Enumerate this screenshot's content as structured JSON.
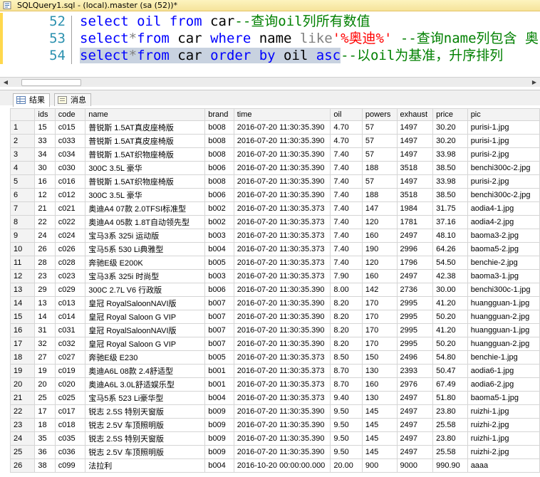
{
  "window": {
    "tab_title": "SQLQuery1.sql - (local).master (sa (52))*"
  },
  "editor": {
    "lines": [
      {
        "number": "52",
        "segments": [
          {
            "cls": "kw",
            "text": "select "
          },
          {
            "cls": "kw",
            "text": "oil "
          },
          {
            "cls": "kw",
            "text": "from "
          },
          {
            "cls": "fn",
            "text": "car"
          },
          {
            "cls": "cm",
            "text": "--查询oil列所有数值"
          }
        ]
      },
      {
        "number": "53",
        "segments": [
          {
            "cls": "kw",
            "text": "select"
          },
          {
            "cls": "gr",
            "text": "*"
          },
          {
            "cls": "kw",
            "text": "from "
          },
          {
            "cls": "fn",
            "text": "car "
          },
          {
            "cls": "kw",
            "text": "where "
          },
          {
            "cls": "fn",
            "text": "name "
          },
          {
            "cls": "gr",
            "text": "like"
          },
          {
            "cls": "str",
            "text": "'%奥迪%'"
          },
          {
            "cls": "cm",
            "text": " --查询name列包含 奥"
          }
        ]
      },
      {
        "number": "54",
        "segments": [
          {
            "cls": "kw sel",
            "text": "select"
          },
          {
            "cls": "gr sel",
            "text": "*"
          },
          {
            "cls": "kw sel",
            "text": "from "
          },
          {
            "cls": "fn sel",
            "text": "car "
          },
          {
            "cls": "kw sel",
            "text": "order by "
          },
          {
            "cls": "fn sel",
            "text": "oil "
          },
          {
            "cls": "kw sel",
            "text": "asc"
          },
          {
            "cls": "cm",
            "text": "--以oil为基准，升序排列"
          }
        ]
      }
    ]
  },
  "result_tabs": {
    "results": "结果",
    "messages": "消息"
  },
  "grid": {
    "columns": [
      "",
      "ids",
      "code",
      "name",
      "brand",
      "time",
      "oil",
      "powers",
      "exhaust",
      "price",
      "pic"
    ],
    "rows": [
      [
        "1",
        "15",
        "c015",
        "普锐斯 1.5AT真皮座椅版",
        "b008",
        "2016-07-20 11:30:35.390",
        "4.70",
        "57",
        "1497",
        "30.20",
        "purisi-1.jpg"
      ],
      [
        "2",
        "33",
        "c033",
        "普锐斯 1.5AT真皮座椅版",
        "b008",
        "2016-07-20 11:30:35.390",
        "4.70",
        "57",
        "1497",
        "30.20",
        "purisi-1.jpg"
      ],
      [
        "3",
        "34",
        "c034",
        "普锐斯 1.5AT织物座椅版",
        "b008",
        "2016-07-20 11:30:35.390",
        "7.40",
        "57",
        "1497",
        "33.98",
        "purisi-2.jpg"
      ],
      [
        "4",
        "30",
        "c030",
        "300C 3.5L 豪华",
        "b006",
        "2016-07-20 11:30:35.390",
        "7.40",
        "188",
        "3518",
        "38.50",
        "benchi300c-2.jpg"
      ],
      [
        "5",
        "16",
        "c016",
        "普锐斯 1.5AT织物座椅版",
        "b008",
        "2016-07-20 11:30:35.390",
        "7.40",
        "57",
        "1497",
        "33.98",
        "purisi-2.jpg"
      ],
      [
        "6",
        "12",
        "c012",
        "300C 3.5L 豪华",
        "b006",
        "2016-07-20 11:30:35.390",
        "7.40",
        "188",
        "3518",
        "38.50",
        "benchi300c-2.jpg"
      ],
      [
        "7",
        "21",
        "c021",
        "奥迪A4 07款 2.0TFSI标准型",
        "b002",
        "2016-07-20 11:30:35.373",
        "7.40",
        "147",
        "1984",
        "31.75",
        "aodia4-1.jpg"
      ],
      [
        "8",
        "22",
        "c022",
        "奥迪A4 05款 1.8T自动领先型",
        "b002",
        "2016-07-20 11:30:35.373",
        "7.40",
        "120",
        "1781",
        "37.16",
        "aodia4-2.jpg"
      ],
      [
        "9",
        "24",
        "c024",
        "宝马3系 325i 运动版",
        "b003",
        "2016-07-20 11:30:35.373",
        "7.40",
        "160",
        "2497",
        "48.10",
        "baoma3-2.jpg"
      ],
      [
        "10",
        "26",
        "c026",
        "宝马5系 530 Li典雅型",
        "b004",
        "2016-07-20 11:30:35.373",
        "7.40",
        "190",
        "2996",
        "64.26",
        "baoma5-2.jpg"
      ],
      [
        "11",
        "28",
        "c028",
        "奔驰E级 E200K",
        "b005",
        "2016-07-20 11:30:35.373",
        "7.40",
        "120",
        "1796",
        "54.50",
        "benchie-2.jpg"
      ],
      [
        "12",
        "23",
        "c023",
        "宝马3系 325i 时尚型",
        "b003",
        "2016-07-20 11:30:35.373",
        "7.90",
        "160",
        "2497",
        "42.38",
        "baoma3-1.jpg"
      ],
      [
        "13",
        "29",
        "c029",
        "300C 2.7L V6 行政版",
        "b006",
        "2016-07-20 11:30:35.390",
        "8.00",
        "142",
        "2736",
        "30.00",
        "benchi300c-1.jpg"
      ],
      [
        "14",
        "13",
        "c013",
        "皇冠 RoyalSaloonNAVI版",
        "b007",
        "2016-07-20 11:30:35.390",
        "8.20",
        "170",
        "2995",
        "41.20",
        "huangguan-1.jpg"
      ],
      [
        "15",
        "14",
        "c014",
        "皇冠 Royal Saloon G VIP",
        "b007",
        "2016-07-20 11:30:35.390",
        "8.20",
        "170",
        "2995",
        "50.20",
        "huangguan-2.jpg"
      ],
      [
        "16",
        "31",
        "c031",
        "皇冠 RoyalSaloonNAVI版",
        "b007",
        "2016-07-20 11:30:35.390",
        "8.20",
        "170",
        "2995",
        "41.20",
        "huangguan-1.jpg"
      ],
      [
        "17",
        "32",
        "c032",
        "皇冠 Royal Saloon G VIP",
        "b007",
        "2016-07-20 11:30:35.390",
        "8.20",
        "170",
        "2995",
        "50.20",
        "huangguan-2.jpg"
      ],
      [
        "18",
        "27",
        "c027",
        "奔驰E级 E230",
        "b005",
        "2016-07-20 11:30:35.373",
        "8.50",
        "150",
        "2496",
        "54.80",
        "benchie-1.jpg"
      ],
      [
        "19",
        "19",
        "c019",
        "奥迪A6L 08款 2.4舒适型",
        "b001",
        "2016-07-20 11:30:35.373",
        "8.70",
        "130",
        "2393",
        "50.47",
        "aodia6-1.jpg"
      ],
      [
        "20",
        "20",
        "c020",
        "奥迪A6L 3.0L舒适娱乐型",
        "b001",
        "2016-07-20 11:30:35.373",
        "8.70",
        "160",
        "2976",
        "67.49",
        "aodia6-2.jpg"
      ],
      [
        "21",
        "25",
        "c025",
        "宝马5系 523 Li豪华型",
        "b004",
        "2016-07-20 11:30:35.373",
        "9.40",
        "130",
        "2497",
        "51.80",
        "baoma5-1.jpg"
      ],
      [
        "22",
        "17",
        "c017",
        "锐志 2.5S 特别天窗版",
        "b009",
        "2016-07-20 11:30:35.390",
        "9.50",
        "145",
        "2497",
        "23.80",
        "ruizhi-1.jpg"
      ],
      [
        "23",
        "18",
        "c018",
        "锐志 2.5V 车顶照明版",
        "b009",
        "2016-07-20 11:30:35.390",
        "9.50",
        "145",
        "2497",
        "25.58",
        "ruizhi-2.jpg"
      ],
      [
        "24",
        "35",
        "c035",
        "锐志 2.5S 特别天窗版",
        "b009",
        "2016-07-20 11:30:35.390",
        "9.50",
        "145",
        "2497",
        "23.80",
        "ruizhi-1.jpg"
      ],
      [
        "25",
        "36",
        "c036",
        "锐志 2.5V 车顶照明版",
        "b009",
        "2016-07-20 11:30:35.390",
        "9.50",
        "145",
        "2497",
        "25.58",
        "ruizhi-2.jpg"
      ],
      [
        "26",
        "38",
        "c099",
        "法拉利",
        "b004",
        "2016-10-20 00:00:00.000",
        "20.00",
        "900",
        "9000",
        "990.90",
        "aaaa"
      ]
    ]
  }
}
